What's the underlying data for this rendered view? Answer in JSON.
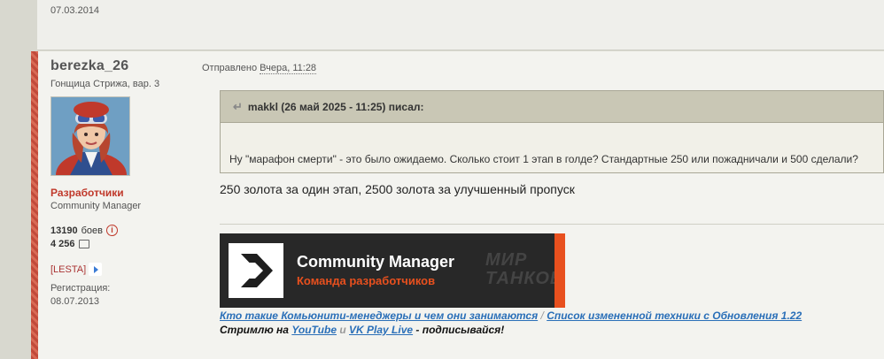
{
  "previous_post": {
    "date": "07.03.2014"
  },
  "author": {
    "username": "berezka_26",
    "rank": "Гонщица Стрижа, вар. 3",
    "group": "Разработчики",
    "role": "Community Manager",
    "battles_value": "13190",
    "battles_label": "боев",
    "posts_count": "4 256",
    "clan_tag": "[LESTA]",
    "registration_label": "Регистрация:",
    "registration_date": "08.07.2013"
  },
  "post": {
    "sent_label": "Отправлено",
    "sent_date": "Вчера, 11:28",
    "quote": {
      "header": "makkl (26 май 2025 - 11:25) писал:",
      "text": "Ну \"марафон смерти\" - это было ожидаемо. Сколько стоит 1 этап в голде? Стандартные 250 или пожадничали и 500 сделали?"
    },
    "reply": "250 золота за один этап, 2500 золота за улучшенный пропуск"
  },
  "signature": {
    "banner_title": "Community Manager",
    "banner_subtitle": "Команда разработчиков",
    "banner_game_line1": "МИР",
    "banner_game_line2": "ТАНКОВ",
    "link1": "Кто такие Комьюнити-менеджеры и чем они занимаются",
    "separator": "/",
    "link2": "Список измененной техники с Обновления 1.22",
    "stream_prefix": "Стримлю на",
    "stream_link1": "YouTube",
    "stream_and": "и",
    "stream_link2": "VK Play Live",
    "stream_suffix": "- подписывайся!"
  },
  "colors": {
    "accent": "#e8501e",
    "group": "#c0392b",
    "link": "#2a6fb8"
  },
  "icons": [
    "info-icon",
    "comment-icon",
    "clan-arrow-icon",
    "quote-icon",
    "banner-logo-icon"
  ]
}
